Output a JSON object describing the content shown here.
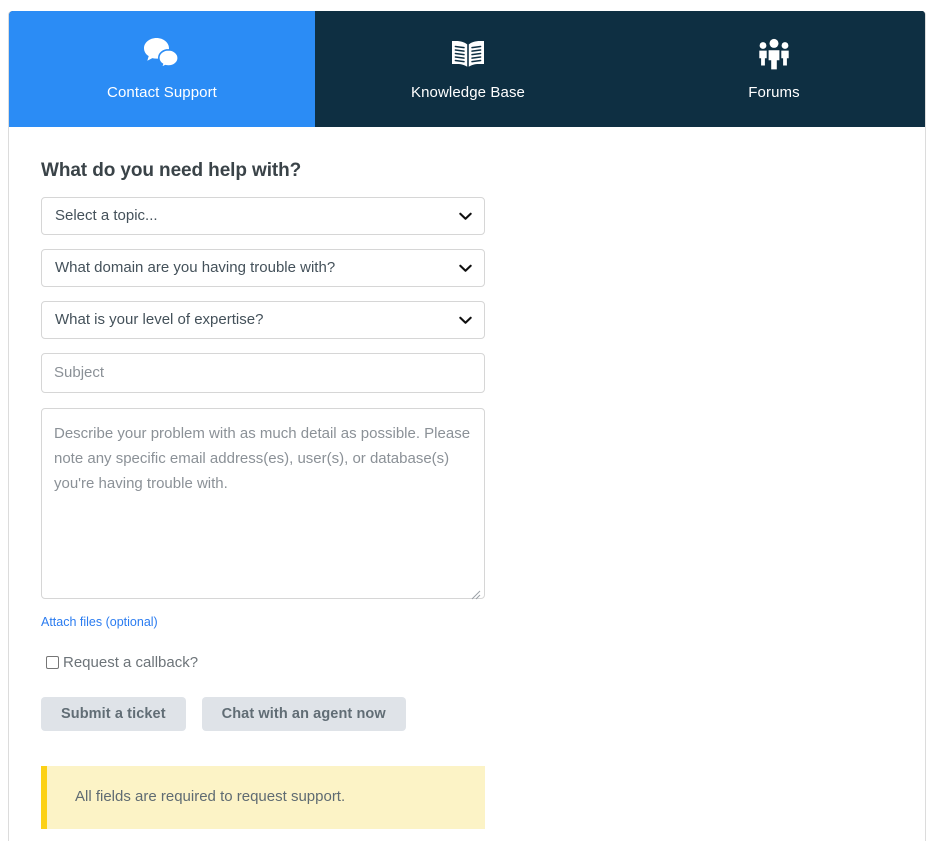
{
  "tabs": [
    {
      "label": "Contact Support",
      "icon": "chat-bubbles-icon",
      "active": true
    },
    {
      "label": "Knowledge Base",
      "icon": "open-book-icon",
      "active": false
    },
    {
      "label": "Forums",
      "icon": "people-group-icon",
      "active": false
    }
  ],
  "form": {
    "heading": "What do you need help with?",
    "topic_select": "Select a topic...",
    "domain_select": "What domain are you having trouble with?",
    "expertise_select": "What is your level of expertise?",
    "subject_placeholder": "Subject",
    "subject_value": "",
    "description_placeholder": "Describe your problem with as much detail as possible. Please note any specific email address(es), user(s), or database(s) you're having trouble with.",
    "description_value": "",
    "attach_link": "Attach files (optional)",
    "callback_label": "Request a callback?",
    "callback_checked": false,
    "submit_label": "Submit a ticket",
    "chat_label": "Chat with an agent now"
  },
  "alert": {
    "message": "All fields are required to request support."
  },
  "colors": {
    "active_tab": "#2b8cf5",
    "tab_bar": "#0e2f42",
    "link": "#2b7cf0",
    "button_bg": "#dfe3e8",
    "alert_bg": "#fcf3c6",
    "alert_border": "#fcd116"
  }
}
